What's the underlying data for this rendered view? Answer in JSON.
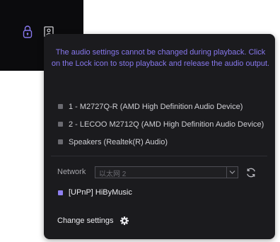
{
  "toolbar": {
    "lock_icon": "lock-icon",
    "profile_icon": "device-profile-icon",
    "lock_color": "#8878ee",
    "profile_color": "#d0d0d4"
  },
  "popup": {
    "warning_text": "The audio settings cannot be changed during playback. Click on the Lock icon to stop playback and release the audio output.",
    "warning_color": "#8878ee",
    "devices": [
      {
        "label": "1 - M2727Q-R (AMD High Definition Audio Device)",
        "indicator_color": "#6a6a70"
      },
      {
        "label": "2 - LECOO M2712Q (AMD High Definition Audio Device)",
        "indicator_color": "#6a6a70"
      },
      {
        "label": "Speakers (Realtek(R) Audio)",
        "indicator_color": "#6a6a70"
      }
    ],
    "network": {
      "label": "Network",
      "selected": "以太网 2",
      "refresh_icon": "refresh-icon"
    },
    "upnp_device": {
      "label": "[UPnP] HiByMusic",
      "indicator_color": "#8f80f2"
    },
    "change_settings": {
      "label": "Change settings",
      "icon": "gear-icon"
    }
  }
}
